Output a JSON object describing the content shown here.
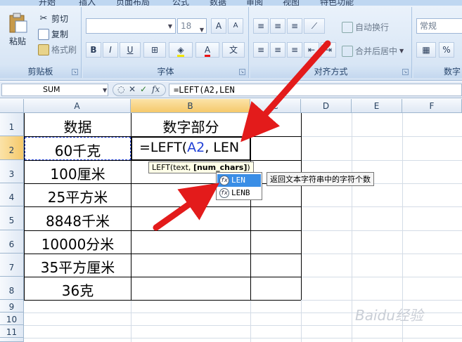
{
  "ribbon": {
    "tabs": [
      "开始",
      "插入",
      "页面布局",
      "公式",
      "数据",
      "审阅",
      "视图",
      "特色功能"
    ],
    "clipboard": {
      "label": "剪贴板",
      "cut": "剪切",
      "copy": "复制",
      "format_painter": "格式刷",
      "paste": "粘贴"
    },
    "font": {
      "label": "字体",
      "font_name": "",
      "font_size": "18",
      "bold": "B",
      "italic": "I",
      "underline": "U",
      "grow": "A",
      "shrink": "A"
    },
    "alignment": {
      "label": "对齐方式",
      "wrap_text": "自动换行",
      "merge_center": "合并后居中"
    },
    "number": {
      "label": "数字",
      "format": "常规",
      "percent": "%"
    }
  },
  "formula_bar": {
    "name_box": "SUM",
    "fx": "fx",
    "formula": "=LEFT(A2,LEN"
  },
  "grid": {
    "columns": [
      "A",
      "B",
      "C",
      "D",
      "E",
      "F"
    ],
    "rows": [
      "1",
      "2",
      "3",
      "4",
      "5",
      "6",
      "7",
      "8",
      "9",
      "10",
      "11"
    ],
    "header_a1": "数据",
    "header_b1": "数字部分",
    "data": [
      "60千克",
      "100厘米",
      "25平方米",
      "8848千米",
      "10000分米",
      "35平方厘米",
      "36克"
    ],
    "editing_cell": {
      "prefix": "=LEFT(",
      "ref": "A2",
      "suffix": ", LEN"
    }
  },
  "function_tooltip": {
    "name": "LEFT(text, ",
    "param": "[num_chars]",
    "close": ")"
  },
  "autocomplete": [
    "LEN",
    "LENB"
  ],
  "description_tooltip": "返回文本字符串中的字符个数",
  "watermark": "Baidu经验",
  "colors": {
    "accent_arrow": "#e31b1b",
    "ref_blue": "#1f3fd6",
    "selection": "#3a8ee6"
  }
}
